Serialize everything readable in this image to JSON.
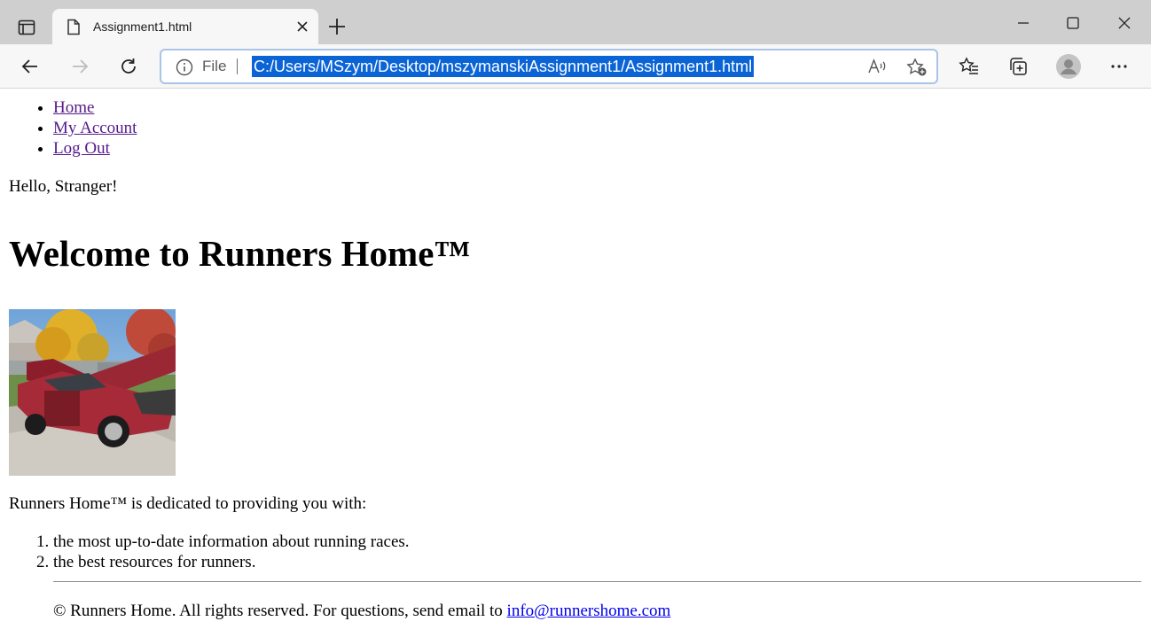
{
  "browser": {
    "tab_title": "Assignment1.html",
    "address_scheme_label": "File",
    "url": "C:/Users/MSzym/Desktop/mszymanskiAssignment1/Assignment1.html"
  },
  "nav": {
    "items": [
      {
        "label": "Home"
      },
      {
        "label": "My Account"
      },
      {
        "label": "Log Out"
      }
    ]
  },
  "greeting": "Hello, Stranger!",
  "heading": "Welcome to Runners Home™",
  "intro": "Runners Home™ is dedicated to providing you with:",
  "features": [
    "the most up-to-date information about running races.",
    "the best resources for runners."
  ],
  "footer": {
    "text": "© Runners Home. All rights reserved. For questions, send email to ",
    "email_link": "info@runnershome.com"
  },
  "colors": {
    "url_highlight": "#0a64d6",
    "visited_link": "#551a8b",
    "link": "#0000ee"
  },
  "icons": [
    "sidebar-toggle-icon",
    "page-icon",
    "close-icon",
    "plus-icon",
    "minimize-icon",
    "maximize-icon",
    "window-close-icon",
    "back-arrow-icon",
    "forward-arrow-icon",
    "reload-icon",
    "info-icon",
    "read-aloud-icon",
    "add-favorite-icon",
    "favorites-icon",
    "collections-icon",
    "profile-avatar-icon",
    "more-icon"
  ]
}
